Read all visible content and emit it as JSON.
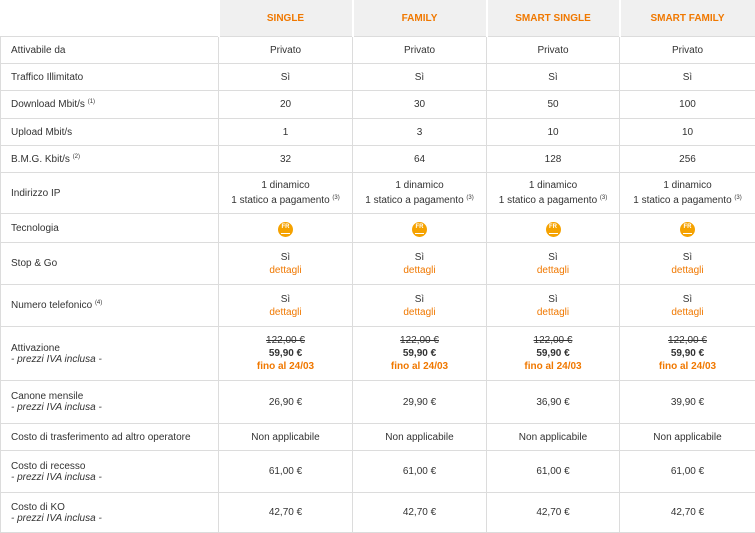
{
  "plans": [
    "SINGLE",
    "FAMILY",
    "SMART SINGLE",
    "SMART FAMILY"
  ],
  "rows": [
    {
      "label": "Attivabile da",
      "values": [
        "Privato",
        "Privato",
        "Privato",
        "Privato"
      ]
    },
    {
      "label": "Traffico Illimitato",
      "values": [
        "Sì",
        "Sì",
        "Sì",
        "Sì"
      ]
    },
    {
      "label": "Download Mbit/s",
      "sup": "(1)",
      "values": [
        "20",
        "30",
        "50",
        "100"
      ]
    },
    {
      "label": "Upload Mbit/s",
      "values": [
        "1",
        "3",
        "10",
        "10"
      ]
    },
    {
      "label": "B.M.G. Kbit/s",
      "sup": "(2)",
      "values": [
        "32",
        "64",
        "128",
        "256"
      ]
    }
  ],
  "ip": {
    "label": "Indirizzo IP",
    "line1": "1 dinamico",
    "line2": "1 statico a pagamento",
    "sup": "(3)"
  },
  "tech": {
    "label": "Tecnologia",
    "icon": "fr-technology-icon",
    "icon_text": "FR"
  },
  "stopgo": {
    "label": "Stop & Go",
    "value": "Sì",
    "link": "dettagli"
  },
  "numero": {
    "label": "Numero telefonico",
    "sup": "(4)",
    "value": "Sì",
    "link": "dettagli"
  },
  "attivazione": {
    "label": "Attivazione",
    "note": "- prezzi IVA inclusa -",
    "old_price": "122,00 €",
    "new_price": "59,90 €",
    "promo": "fino al 24/03"
  },
  "canone": {
    "label": "Canone mensile",
    "note": "- prezzi IVA inclusa -",
    "values": [
      "26,90 €",
      "29,90 €",
      "36,90 €",
      "39,90 €"
    ]
  },
  "trasferimento": {
    "label": "Costo di trasferimento ad altro operatore",
    "value": "Non applicabile"
  },
  "recesso": {
    "label": "Costo di recesso",
    "note": "- prezzi IVA inclusa -",
    "value": "61,00 €"
  },
  "ko": {
    "label": "Costo di KO",
    "note": "- prezzi IVA inclusa -",
    "value": "42,70 €"
  },
  "colors": {
    "accent": "#f07800",
    "header_bg": "#f0f0f0",
    "border": "#dcdcdc",
    "icon": "#f5a200"
  }
}
